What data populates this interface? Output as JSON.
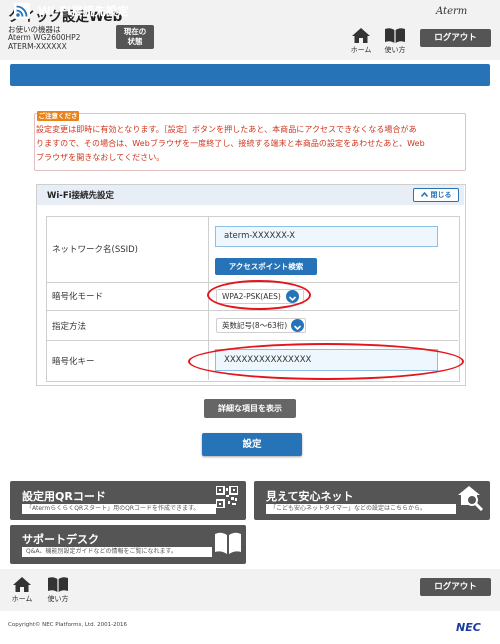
{
  "header": {
    "app_title": "クイック設定Web",
    "device_label": "お使いの機器は",
    "device_model": "Aterm WG2600HP2",
    "device_ssid": "ATERM-XXXXXX",
    "status_button": [
      "現在の",
      "状態"
    ],
    "brand": "Aterm",
    "home_label": "ホーム",
    "help_label": "使い方",
    "logout_label": "ログアウト"
  },
  "page": {
    "title": "Wi-Fi接続先設定"
  },
  "warning": {
    "badge": "ご注意ください",
    "lines": [
      "設定変更は即時に有効となります。［設定］ボタンを押したあと、本商品にアクセスできなくなる場合があ",
      "りますので、その場合は、Webブラウザを一度終了し、接続する端末と本商品の設定をあわせたあと、Web",
      "ブラウザを開きなおしてください。"
    ]
  },
  "section": {
    "title": "Wi-Fi接続先設定",
    "close_label": "閉じる",
    "ssid_label": "ネットワーク名(SSID)",
    "ssid_value": "aterm-XXXXXX-X",
    "ap_search_label": "アクセスポイント検索",
    "encryption_label": "暗号化モード",
    "encryption_value": "WPA2-PSK(AES)",
    "method_label": "指定方法",
    "method_value": "英数記号(8〜63桁)",
    "key_label": "暗号化キー",
    "key_value": "XXXXXXXXXXXXXXX"
  },
  "buttons": {
    "detail": "詳細な項目を表示",
    "set": "設定"
  },
  "cards": {
    "qr": {
      "title": "設定用QRコード",
      "desc": "「AtermらくらくQRスタート」用のQRコードを作成できます。"
    },
    "safety": {
      "title": "見えて安心ネット",
      "desc": "「こども安心ネットタイマー」などの設定はこちらから。"
    },
    "support": {
      "title": "サポートデスク",
      "desc": "Q&A、機能別設定ガイドなどの情報をご覧になれます。"
    }
  },
  "footer": {
    "home_label": "ホーム",
    "help_label": "使い方",
    "logout_label": "ログアウト",
    "copyright": "Copyright© NEC Platforms, Ltd. 2001-2016",
    "nec_logo": "NEC"
  },
  "colors": {
    "accent": "#2673b8",
    "dark_button": "#555555",
    "warning_text": "#d0341c",
    "warning_badge": "#e9831c",
    "highlight_ellipse": "#e3141b"
  }
}
